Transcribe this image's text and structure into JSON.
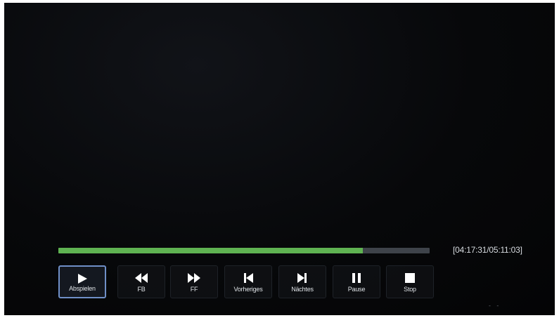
{
  "player": {
    "time": "[04:17:31/05:11:03]",
    "progress": 0.82,
    "accent_color": "#5fb352",
    "track_color": "#3e434a",
    "focus_color": "#6f8fc7"
  },
  "controls": [
    {
      "id": "play",
      "label": "Abspielen",
      "icon": "play-icon",
      "active": true
    },
    {
      "id": "rewind",
      "label": "FB",
      "icon": "rewind-icon",
      "active": false
    },
    {
      "id": "fast-forward",
      "label": "FF",
      "icon": "fast-forward-icon",
      "active": false
    },
    {
      "id": "previous",
      "label": "Vorheriges",
      "icon": "skip-previous-icon",
      "active": false
    },
    {
      "id": "next",
      "label": "Nächtes",
      "icon": "skip-next-icon",
      "active": false
    },
    {
      "id": "pause",
      "label": "Pause",
      "icon": "pause-icon",
      "active": false
    },
    {
      "id": "stop",
      "label": "Stop",
      "icon": "stop-icon",
      "active": false
    }
  ],
  "footer": {
    "indicator": "- -"
  }
}
